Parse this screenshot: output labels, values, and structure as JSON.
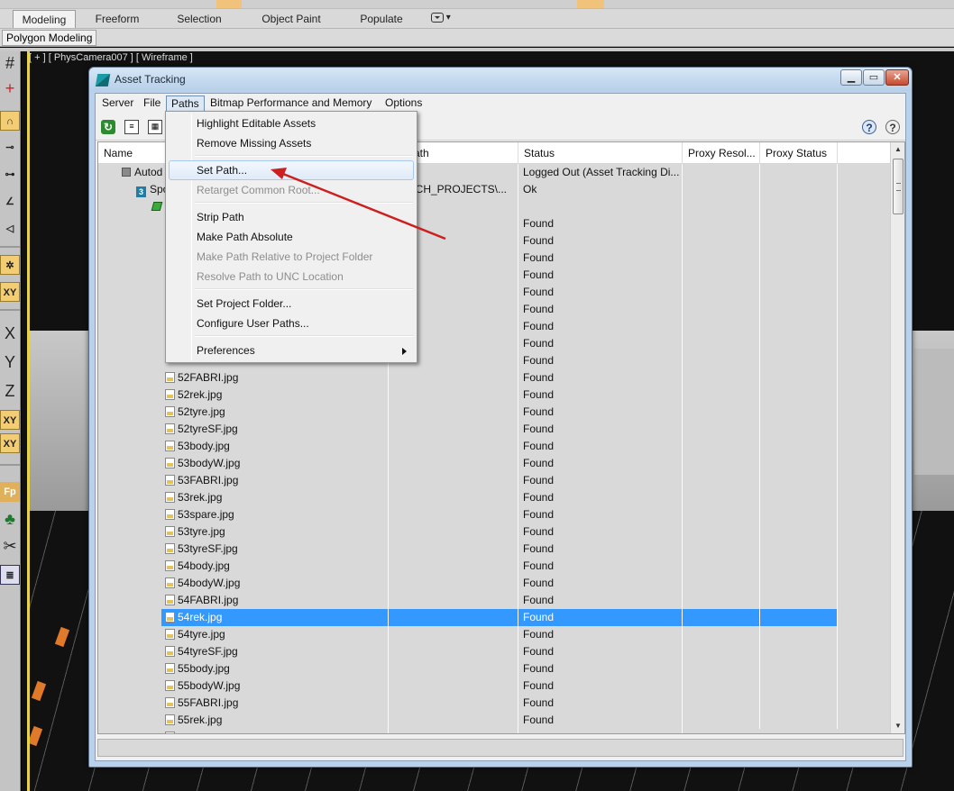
{
  "ribbon": {
    "tabs": [
      "Modeling",
      "Freeform",
      "Selection",
      "Object Paint",
      "Populate"
    ],
    "active_tab": "Modeling",
    "sub_tab": "Polygon Modeling"
  },
  "left_toolbar": {
    "labels": [
      "X",
      "Y",
      "Z",
      "XY",
      "XY",
      "Fp"
    ]
  },
  "viewport": {
    "label": "[ + ] [ PhysCamera007 ] [ Wireframe ]"
  },
  "window": {
    "title": "Asset Tracking",
    "controls": [
      "minimize",
      "maximize",
      "close"
    ],
    "menu": [
      "Server",
      "File",
      "Paths",
      "Bitmap Performance and Memory",
      "Options"
    ],
    "open_menu": "Paths"
  },
  "table": {
    "headers": [
      "Name",
      "Full Path",
      "Status",
      "Proxy Resol...",
      "Proxy Status"
    ],
    "visible_header_fragment": "ath",
    "tree_rows": [
      {
        "name": "Autod",
        "path": "",
        "status": "Logged Out (Asset Tracking Di..."
      },
      {
        "name": "Spo",
        "path": "RCH_PROJECTS\\...",
        "status": "Ok"
      },
      {
        "name": "",
        "path": "",
        "status": ""
      }
    ],
    "hidden_found_rows": 9,
    "files": [
      {
        "name": "52FABRI.jpg",
        "status": "Found"
      },
      {
        "name": "52rek.jpg",
        "status": "Found"
      },
      {
        "name": "52tyre.jpg",
        "status": "Found"
      },
      {
        "name": "52tyreSF.jpg",
        "status": "Found"
      },
      {
        "name": "53body.jpg",
        "status": "Found"
      },
      {
        "name": "53bodyW.jpg",
        "status": "Found"
      },
      {
        "name": "53FABRI.jpg",
        "status": "Found"
      },
      {
        "name": "53rek.jpg",
        "status": "Found"
      },
      {
        "name": "53spare.jpg",
        "status": "Found"
      },
      {
        "name": "53tyre.jpg",
        "status": "Found"
      },
      {
        "name": "53tyreSF.jpg",
        "status": "Found"
      },
      {
        "name": "54body.jpg",
        "status": "Found"
      },
      {
        "name": "54bodyW.jpg",
        "status": "Found"
      },
      {
        "name": "54FABRI.jpg",
        "status": "Found"
      },
      {
        "name": "54rek.jpg",
        "status": "Found",
        "selected": true
      },
      {
        "name": "54tyre.jpg",
        "status": "Found"
      },
      {
        "name": "54tyreSF.jpg",
        "status": "Found"
      },
      {
        "name": "55body.jpg",
        "status": "Found"
      },
      {
        "name": "55bodyW.jpg",
        "status": "Found"
      },
      {
        "name": "55FABRI.jpg",
        "status": "Found"
      },
      {
        "name": "55rek.jpg",
        "status": "Found"
      }
    ]
  },
  "paths_menu": {
    "items": [
      {
        "label": "Highlight Editable Assets",
        "enabled": true
      },
      {
        "label": "Remove Missing Assets",
        "enabled": true
      },
      {
        "separator": true
      },
      {
        "label": "Set Path...",
        "enabled": true,
        "highlighted": true
      },
      {
        "label": "Retarget Common Root...",
        "enabled": false
      },
      {
        "separator": true
      },
      {
        "label": "Strip Path",
        "enabled": true
      },
      {
        "label": "Make Path Absolute",
        "enabled": true
      },
      {
        "label": "Make Path Relative to Project Folder",
        "enabled": false
      },
      {
        "label": "Resolve Path to UNC Location",
        "enabled": false
      },
      {
        "separator": true
      },
      {
        "label": "Set Project Folder...",
        "enabled": true
      },
      {
        "label": "Configure User Paths...",
        "enabled": true
      },
      {
        "separator": true
      },
      {
        "label": "Preferences",
        "enabled": true,
        "submenu": true
      }
    ]
  },
  "colors": {
    "selection": "#3399ff",
    "annotation_arrow": "#cc1f1f",
    "title_bar": "#b9d1ea",
    "viewport_highlight": "#e6d44a"
  }
}
